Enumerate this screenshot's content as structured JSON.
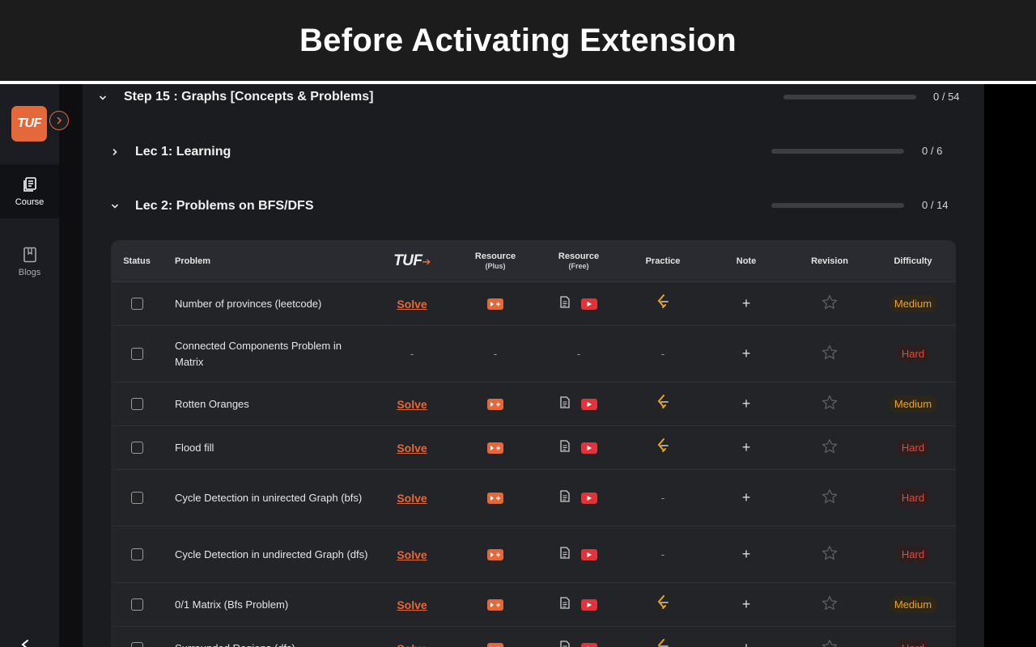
{
  "banner": {
    "title": "Before Activating Extension"
  },
  "sidebar": {
    "logo_text": "TUF",
    "items": [
      {
        "label": "Course",
        "icon": "book-icon",
        "active": true
      },
      {
        "label": "Blogs",
        "icon": "bookmark-icon",
        "active": false
      }
    ]
  },
  "step": {
    "title": "Step 15 : Graphs [Concepts & Problems]",
    "progress": "0 / 54",
    "fraction": 0
  },
  "lectures": [
    {
      "title": "Lec 1: Learning",
      "progress": "0 / 6",
      "fraction": 0,
      "expanded": false
    },
    {
      "title": "Lec 2: Problems on BFS/DFS",
      "progress": "0 / 14",
      "fraction": 0,
      "expanded": true
    }
  ],
  "table": {
    "headers": {
      "status": "Status",
      "problem": "Problem",
      "tuf": "TUF",
      "resource_plus": "Resource",
      "resource_plus_sub": "(Plus)",
      "resource_free": "Resource",
      "resource_free_sub": "(Free)",
      "practice": "Practice",
      "note": "Note",
      "revision": "Revision",
      "difficulty": "Difficulty"
    },
    "solve_label": "Solve",
    "dash": "-",
    "plus": "+",
    "rows": [
      {
        "problem": "Number of provinces (leetcode)",
        "has_solve": true,
        "has_plus": true,
        "has_free": true,
        "has_practice": true,
        "difficulty": "Medium"
      },
      {
        "problem": "Connected Components Problem in Matrix",
        "has_solve": false,
        "has_plus": false,
        "has_free": false,
        "has_practice": false,
        "difficulty": "Hard"
      },
      {
        "problem": "Rotten Oranges",
        "has_solve": true,
        "has_plus": true,
        "has_free": true,
        "has_practice": true,
        "difficulty": "Medium"
      },
      {
        "problem": "Flood fill",
        "has_solve": true,
        "has_plus": true,
        "has_free": true,
        "has_practice": true,
        "difficulty": "Hard"
      },
      {
        "problem": "Cycle Detection in unirected Graph (bfs)",
        "has_solve": true,
        "has_plus": true,
        "has_free": true,
        "has_practice": false,
        "difficulty": "Hard"
      },
      {
        "problem": "Cycle Detection in undirected Graph (dfs)",
        "has_solve": true,
        "has_plus": true,
        "has_free": true,
        "has_practice": false,
        "difficulty": "Hard"
      },
      {
        "problem": "0/1 Matrix (Bfs Problem)",
        "has_solve": true,
        "has_plus": true,
        "has_free": true,
        "has_practice": true,
        "difficulty": "Medium"
      },
      {
        "problem": "Surrounded Regions (dfs)",
        "has_solve": true,
        "has_plus": true,
        "has_free": true,
        "has_practice": true,
        "difficulty": "Hard"
      }
    ]
  },
  "colors": {
    "accent": "#e5683a",
    "medium": "#f0a41a",
    "hard": "#e8453c",
    "youtube": "#e0343a"
  }
}
